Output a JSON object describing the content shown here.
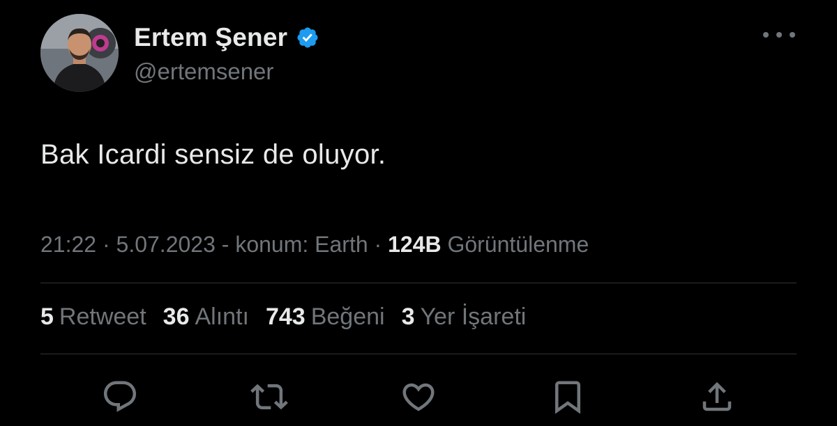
{
  "author": {
    "name": "Ertem Şener",
    "handle": "@ertemsener",
    "verified": true
  },
  "tweet": {
    "text": "Bak Icardi sensiz de oluyor."
  },
  "meta": {
    "time": "21:22",
    "date": "5.07.2023",
    "location": "konum: Earth",
    "views_count": "124B",
    "views_label": "Görüntülenme"
  },
  "stats": [
    {
      "count": "5",
      "label": "Retweet"
    },
    {
      "count": "36",
      "label": "Alıntı"
    },
    {
      "count": "743",
      "label": "Beğeni"
    },
    {
      "count": "3",
      "label": "Yer İşareti"
    }
  ],
  "actions": [
    {
      "icon": "reply-icon"
    },
    {
      "icon": "retweet-icon"
    },
    {
      "icon": "like-icon"
    },
    {
      "icon": "bookmark-icon"
    },
    {
      "icon": "share-icon"
    }
  ],
  "colors": {
    "background": "#000000",
    "primary_text": "#e7e9ea",
    "secondary_text": "#71767b",
    "verified_badge": "#1d9bf0",
    "divider": "#2f3336"
  }
}
